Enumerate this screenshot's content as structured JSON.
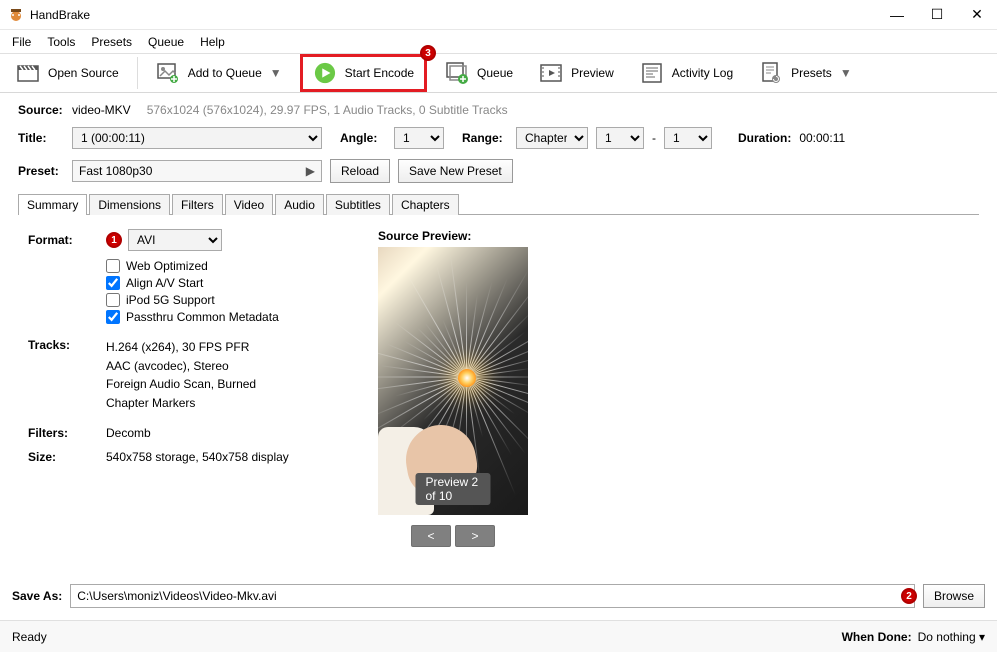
{
  "app": {
    "title": "HandBrake"
  },
  "menu": {
    "file": "File",
    "tools": "Tools",
    "presets": "Presets",
    "queue": "Queue",
    "help": "Help"
  },
  "toolbar": {
    "open_source": "Open Source",
    "add_to_queue": "Add to Queue",
    "start_encode": "Start Encode",
    "queue": "Queue",
    "preview": "Preview",
    "activity_log": "Activity Log",
    "presets": "Presets"
  },
  "badges": {
    "b1": "1",
    "b2": "2",
    "b3": "3"
  },
  "source": {
    "label": "Source:",
    "name": "video-MKV",
    "info": "576x1024 (576x1024), 29.97 FPS, 1 Audio Tracks, 0 Subtitle Tracks"
  },
  "titlebar_row": {
    "title_label": "Title:",
    "title_value": "1  (00:00:11)",
    "angle_label": "Angle:",
    "angle_value": "1",
    "range_label": "Range:",
    "range_type": "Chapters",
    "range_from": "1",
    "range_sep": "-",
    "range_to": "1",
    "duration_label": "Duration:",
    "duration_value": "00:00:11"
  },
  "preset_row": {
    "label": "Preset:",
    "value": "Fast 1080p30",
    "reload": "Reload",
    "save_new": "Save New Preset"
  },
  "tabs": {
    "summary": "Summary",
    "dimensions": "Dimensions",
    "filters": "Filters",
    "video": "Video",
    "audio": "Audio",
    "subtitles": "Subtitles",
    "chapters": "Chapters"
  },
  "summary": {
    "format_label": "Format:",
    "format_value": "AVI",
    "chk_web": "Web Optimized",
    "chk_align": "Align A/V Start",
    "chk_ipod": "iPod 5G Support",
    "chk_meta": "Passthru Common Metadata",
    "chk_web_on": false,
    "chk_align_on": true,
    "chk_ipod_on": false,
    "chk_meta_on": true,
    "tracks_label": "Tracks:",
    "tracks_1": "H.264 (x264), 30 FPS PFR",
    "tracks_2": "AAC (avcodec), Stereo",
    "tracks_3": "Foreign Audio Scan, Burned",
    "tracks_4": "Chapter Markers",
    "filters_label": "Filters:",
    "filters_value": "Decomb",
    "size_label": "Size:",
    "size_value": "540x758 storage, 540x758 display",
    "preview_label": "Source Preview:",
    "preview_counter": "Preview 2 of 10",
    "prev": "<",
    "next": ">"
  },
  "saveas": {
    "label": "Save As:",
    "path": "C:\\Users\\moniz\\Videos\\Video-Mkv.avi",
    "browse": "Browse"
  },
  "status": {
    "ready": "Ready",
    "when_done_label": "When Done:",
    "when_done_value": "Do nothing"
  }
}
